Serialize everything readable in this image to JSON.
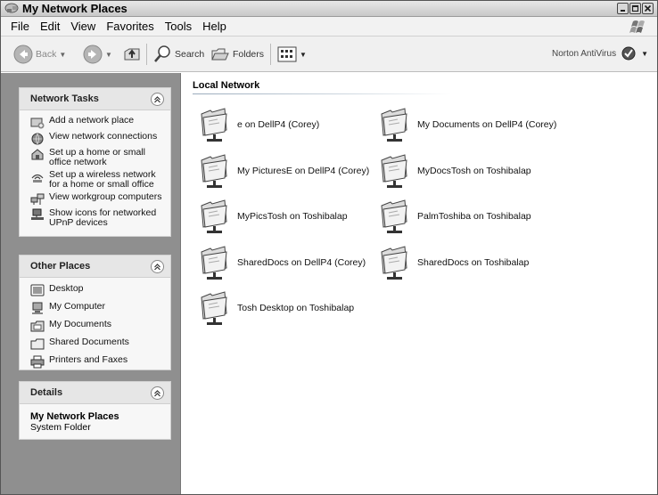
{
  "window": {
    "title": "My Network Places",
    "title_icon": "network-places-icon"
  },
  "menu": [
    "File",
    "Edit",
    "View",
    "Favorites",
    "Tools",
    "Help"
  ],
  "toolbar": {
    "back": "Back",
    "search": "Search",
    "folders": "Folders",
    "norton": "Norton AntiVirus"
  },
  "panels": {
    "network_tasks": {
      "title": "Network Tasks",
      "items": [
        {
          "label": "Add a network place",
          "icon": "add-network-place-icon"
        },
        {
          "label": "View network connections",
          "icon": "network-connections-icon"
        },
        {
          "label": "Set up a home or small office network",
          "icon": "home-network-icon"
        },
        {
          "label": "Set up a wireless network for a home or small office",
          "icon": "wireless-network-icon"
        },
        {
          "label": "View workgroup computers",
          "icon": "workgroup-icon"
        },
        {
          "label": "Show icons for networked UPnP devices",
          "icon": "upnp-icon"
        }
      ]
    },
    "other_places": {
      "title": "Other Places",
      "items": [
        {
          "label": "Desktop",
          "icon": "desktop-icon"
        },
        {
          "label": "My Computer",
          "icon": "my-computer-icon"
        },
        {
          "label": "My Documents",
          "icon": "my-documents-icon"
        },
        {
          "label": "Shared Documents",
          "icon": "shared-documents-icon"
        },
        {
          "label": "Printers and Faxes",
          "icon": "printer-icon"
        }
      ]
    },
    "details": {
      "title": "Details",
      "name": "My Network Places",
      "type": "System Folder"
    }
  },
  "content": {
    "group": "Local Network",
    "items": [
      "e on DellP4 (Corey)",
      "My Documents on DellP4 (Corey)",
      "My PicturesE on DellP4 (Corey)",
      "MyDocsTosh on Toshibalap",
      "MyPicsTosh on Toshibalap",
      "PalmToshiba on Toshibalap",
      "SharedDocs on DellP4 (Corey)",
      "SharedDocs on Toshibalap",
      "Tosh Desktop on Toshibalap"
    ]
  }
}
